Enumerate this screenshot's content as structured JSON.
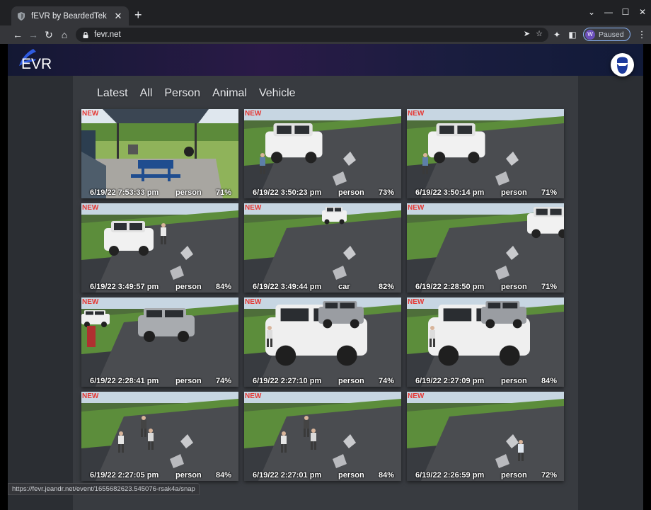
{
  "browser": {
    "tab_title": "fEVR by BeardedTek",
    "tab_close": "✕",
    "new_tab": "+",
    "url": "fevr.net",
    "profile_initial": "W",
    "profile_status": "Paused",
    "status_url": "https://fevr.jeandr.net/event/1655682623.545076-rsak4a/snap",
    "window_controls": [
      "⌄",
      "—",
      "☐",
      "✕"
    ]
  },
  "app": {
    "logo_text": "EVR",
    "accent": "#1e3fa8"
  },
  "filters": [
    "Latest",
    "All",
    "Person",
    "Animal",
    "Vehicle"
  ],
  "new_badge": "NEW",
  "events": [
    {
      "datetime": "6/19/22 7:53:33 pm",
      "label": "person",
      "confidence": "71%",
      "scene": "patio"
    },
    {
      "datetime": "6/19/22 3:50:23 pm",
      "label": "person",
      "confidence": "73%",
      "scene": "driveway-truck"
    },
    {
      "datetime": "6/19/22 3:50:14 pm",
      "label": "person",
      "confidence": "71%",
      "scene": "driveway-truck"
    },
    {
      "datetime": "6/19/22 3:49:57 pm",
      "label": "person",
      "confidence": "84%",
      "scene": "driveway-truck-close"
    },
    {
      "datetime": "6/19/22 3:49:44 pm",
      "label": "car",
      "confidence": "82%",
      "scene": "driveway-far"
    },
    {
      "datetime": "6/19/22 2:28:50 pm",
      "label": "person",
      "confidence": "71%",
      "scene": "driveway-right"
    },
    {
      "datetime": "6/19/22 2:28:41 pm",
      "label": "person",
      "confidence": "74%",
      "scene": "driveway-suv"
    },
    {
      "datetime": "6/19/22 2:27:10 pm",
      "label": "person",
      "confidence": "74%",
      "scene": "suv-close"
    },
    {
      "datetime": "6/19/22 2:27:09 pm",
      "label": "person",
      "confidence": "84%",
      "scene": "suv-close"
    },
    {
      "datetime": "6/19/22 2:27:05 pm",
      "label": "person",
      "confidence": "84%",
      "scene": "driveway-people"
    },
    {
      "datetime": "6/19/22 2:27:01 pm",
      "label": "person",
      "confidence": "84%",
      "scene": "driveway-people"
    },
    {
      "datetime": "6/19/22 2:26:59 pm",
      "label": "person",
      "confidence": "72%",
      "scene": "driveway-person"
    }
  ]
}
